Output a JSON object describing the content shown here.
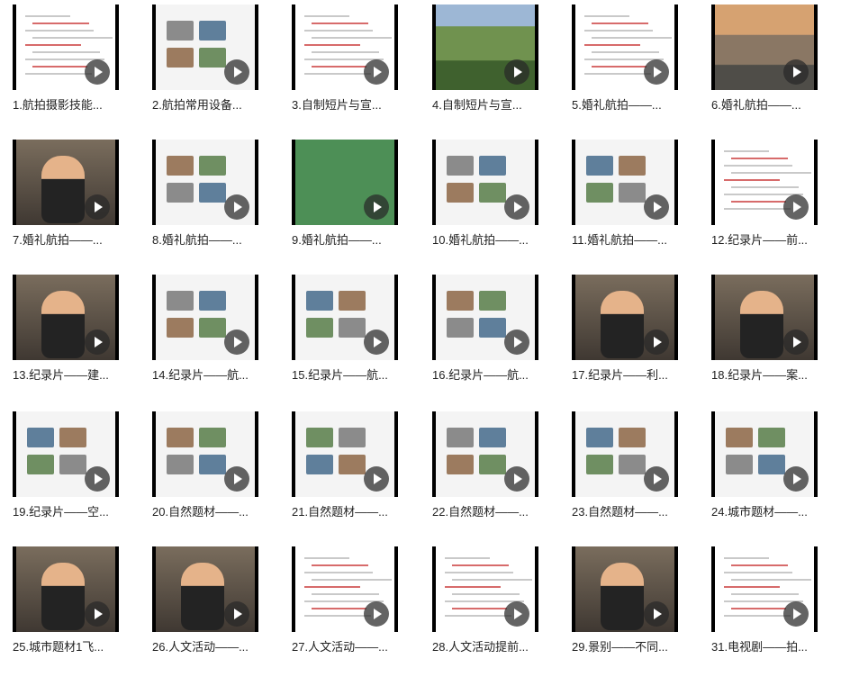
{
  "videos": [
    {
      "title": "1.航拍摄影技能...",
      "scene": "doc"
    },
    {
      "title": "2.航拍常用设备...",
      "scene": "white"
    },
    {
      "title": "3.自制短片与宣...",
      "scene": "doc"
    },
    {
      "title": "4.自制短片与宣...",
      "scene": "nature"
    },
    {
      "title": "5.婚礼航拍——...",
      "scene": "doc"
    },
    {
      "title": "6.婚礼航拍——...",
      "scene": "sunset"
    },
    {
      "title": "7.婚礼航拍——...",
      "scene": "room"
    },
    {
      "title": "8.婚礼航拍——...",
      "scene": "white"
    },
    {
      "title": "9.婚礼航拍——...",
      "scene": "green"
    },
    {
      "title": "10.婚礼航拍——...",
      "scene": "white"
    },
    {
      "title": "11.婚礼航拍——...",
      "scene": "white"
    },
    {
      "title": "12.纪录片——前...",
      "scene": "doc"
    },
    {
      "title": "13.纪录片——建...",
      "scene": "room"
    },
    {
      "title": "14.纪录片——航...",
      "scene": "white"
    },
    {
      "title": "15.纪录片——航...",
      "scene": "white"
    },
    {
      "title": "16.纪录片——航...",
      "scene": "white"
    },
    {
      "title": "17.纪录片——利...",
      "scene": "room"
    },
    {
      "title": "18.纪录片——案...",
      "scene": "room"
    },
    {
      "title": "19.纪录片——空...",
      "scene": "white"
    },
    {
      "title": "20.自然题材——...",
      "scene": "white"
    },
    {
      "title": "21.自然题材——...",
      "scene": "white"
    },
    {
      "title": "22.自然题材——...",
      "scene": "white"
    },
    {
      "title": "23.自然题材——...",
      "scene": "white"
    },
    {
      "title": "24.城市题材——...",
      "scene": "white"
    },
    {
      "title": "25.城市题材1飞...",
      "scene": "room"
    },
    {
      "title": "26.人文活动——...",
      "scene": "room"
    },
    {
      "title": "27.人文活动——...",
      "scene": "doc"
    },
    {
      "title": "28.人文活动提前...",
      "scene": "doc"
    },
    {
      "title": "29.景别——不同...",
      "scene": "room"
    },
    {
      "title": "31.电视剧——拍...",
      "scene": "doc"
    }
  ]
}
